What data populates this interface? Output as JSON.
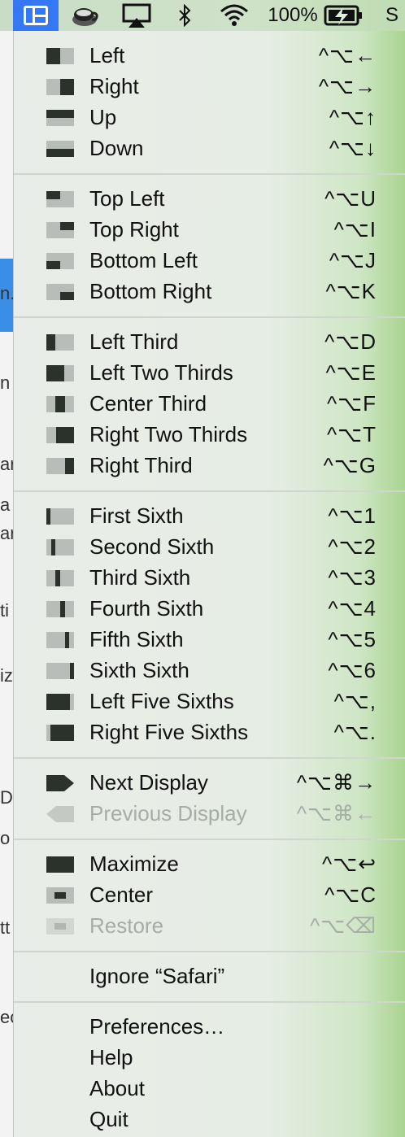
{
  "menubar": {
    "battery": "100%",
    "cut_label": "S"
  },
  "bg_window_fragments": [
    "n.",
    "n",
    "ar",
    "a",
    "ar",
    "ti",
    "iz",
    "D",
    "o",
    "tt",
    "ec"
  ],
  "menu": {
    "sections": [
      [
        {
          "label": "Left",
          "shortcut": "^⌥←",
          "icon": "left-half-icon"
        },
        {
          "label": "Right",
          "shortcut": "^⌥→",
          "icon": "right-half-icon"
        },
        {
          "label": "Up",
          "shortcut": "^⌥↑",
          "icon": "top-half-icon"
        },
        {
          "label": "Down",
          "shortcut": "^⌥↓",
          "icon": "bottom-half-icon"
        }
      ],
      [
        {
          "label": "Top Left",
          "shortcut": "^⌥U",
          "icon": "top-left-icon"
        },
        {
          "label": "Top Right",
          "shortcut": "^⌥I",
          "icon": "top-right-icon"
        },
        {
          "label": "Bottom Left",
          "shortcut": "^⌥J",
          "icon": "bottom-left-icon"
        },
        {
          "label": "Bottom Right",
          "shortcut": "^⌥K",
          "icon": "bottom-right-icon"
        }
      ],
      [
        {
          "label": "Left Third",
          "shortcut": "^⌥D",
          "icon": "left-third-icon"
        },
        {
          "label": "Left Two Thirds",
          "shortcut": "^⌥E",
          "icon": "left-two-thirds-icon"
        },
        {
          "label": "Center Third",
          "shortcut": "^⌥F",
          "icon": "center-third-icon"
        },
        {
          "label": "Right Two Thirds",
          "shortcut": "^⌥T",
          "icon": "right-two-thirds-icon"
        },
        {
          "label": "Right Third",
          "shortcut": "^⌥G",
          "icon": "right-third-icon"
        }
      ],
      [
        {
          "label": "First Sixth",
          "shortcut": "^⌥1",
          "icon": "first-sixth-icon"
        },
        {
          "label": "Second Sixth",
          "shortcut": "^⌥2",
          "icon": "second-sixth-icon"
        },
        {
          "label": "Third Sixth",
          "shortcut": "^⌥3",
          "icon": "third-sixth-icon"
        },
        {
          "label": "Fourth Sixth",
          "shortcut": "^⌥4",
          "icon": "fourth-sixth-icon"
        },
        {
          "label": "Fifth Sixth",
          "shortcut": "^⌥5",
          "icon": "fifth-sixth-icon"
        },
        {
          "label": "Sixth Sixth",
          "shortcut": "^⌥6",
          "icon": "sixth-sixth-icon"
        },
        {
          "label": "Left Five Sixths",
          "shortcut": "^⌥,",
          "icon": "left-five-sixths-icon"
        },
        {
          "label": "Right Five Sixths",
          "shortcut": "^⌥.",
          "icon": "right-five-sixths-icon"
        }
      ],
      [
        {
          "label": "Next Display",
          "shortcut": "^⌥⌘→",
          "icon": "next-display-icon"
        },
        {
          "label": "Previous Display",
          "shortcut": "^⌥⌘←",
          "icon": "previous-display-icon",
          "disabled": true
        }
      ],
      [
        {
          "label": "Maximize",
          "shortcut": "^⌥↩",
          "icon": "maximize-icon"
        },
        {
          "label": "Center",
          "shortcut": "^⌥C",
          "icon": "center-icon"
        },
        {
          "label": "Restore",
          "shortcut": "^⌥⌫",
          "icon": "restore-icon",
          "disabled": true
        }
      ],
      [
        {
          "label": "Ignore “Safari”",
          "shortcut": ""
        }
      ],
      [
        {
          "label": "Preferences…",
          "shortcut": ""
        },
        {
          "label": "Help",
          "shortcut": ""
        },
        {
          "label": "About",
          "shortcut": ""
        },
        {
          "label": "Quit",
          "shortcut": ""
        }
      ]
    ]
  }
}
